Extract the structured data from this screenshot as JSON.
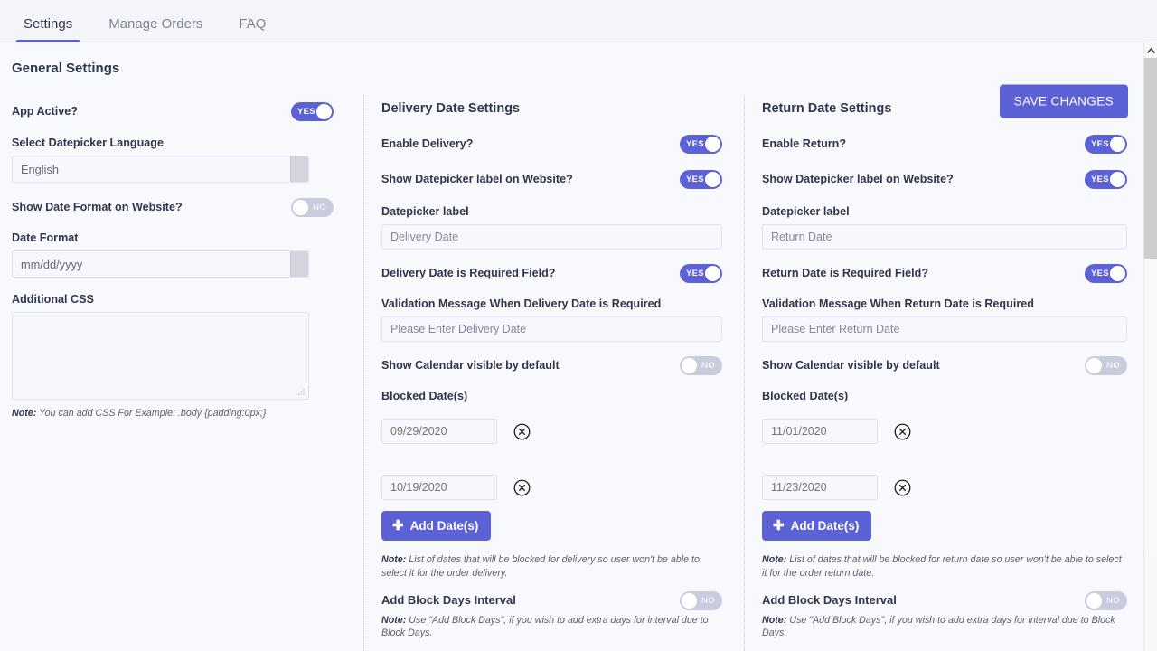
{
  "tabs": [
    {
      "label": "Settings",
      "active": true
    },
    {
      "label": "Manage Orders",
      "active": false
    },
    {
      "label": "FAQ",
      "active": false
    }
  ],
  "header": {
    "title": "General Settings",
    "save_label": "SAVE CHANGES"
  },
  "colors": {
    "accent": "#5c61d6",
    "toggle_on": "#5c61d6",
    "toggle_off": "#c9ccdd",
    "text": "#31364f",
    "page_bg": "#f8f9fc"
  },
  "general": {
    "app_active": {
      "label": "App Active?",
      "value": "YES",
      "on": true
    },
    "language": {
      "label": "Select Datepicker Language",
      "value": "English"
    },
    "show_date_format": {
      "label": "Show Date Format on Website?",
      "value": "NO",
      "on": false
    },
    "date_format": {
      "label": "Date Format",
      "value": "mm/dd/yyyy"
    },
    "additional_css": {
      "label": "Additional CSS",
      "value": "",
      "placeholder": ""
    },
    "css_note_prefix": "Note:",
    "css_note": " You can add CSS For Example: .body {padding:0px;}"
  },
  "delivery": {
    "title": "Delivery Date Settings",
    "enable": {
      "label": "Enable Delivery?",
      "value": "YES",
      "on": true
    },
    "show_label": {
      "label": "Show Datepicker label on Website?",
      "value": "YES",
      "on": true
    },
    "datepicker_label": {
      "label": "Datepicker label",
      "value": "Delivery Date"
    },
    "required": {
      "label": "Delivery Date is Required Field?",
      "value": "YES",
      "on": true
    },
    "validation": {
      "label": "Validation Message When Delivery Date is Required",
      "value": "Please Enter Delivery Date"
    },
    "calendar_visible": {
      "label": "Show Calendar visible by default",
      "value": "NO",
      "on": false
    },
    "blocked_label": "Blocked Date(s)",
    "blocked_dates": [
      "09/29/2020",
      "10/19/2020"
    ],
    "add_button": "Add Date(s)",
    "note_prefix": "Note:",
    "note": " List of dates that will be blocked for delivery so user won't be able to select it for the order delivery.",
    "block_interval": {
      "label": "Add Block Days Interval",
      "value": "NO",
      "on": false
    },
    "block_note_prefix": "Note:",
    "block_note": " Use \"Add Block Days\", if you wish to add extra days for interval due to Block Days."
  },
  "return": {
    "title": "Return Date Settings",
    "enable": {
      "label": "Enable Return?",
      "value": "YES",
      "on": true
    },
    "show_label": {
      "label": "Show Datepicker label on Website?",
      "value": "YES",
      "on": true
    },
    "datepicker_label": {
      "label": "Datepicker label",
      "value": "Return Date"
    },
    "required": {
      "label": "Return Date is Required Field?",
      "value": "YES",
      "on": true
    },
    "validation": {
      "label": "Validation Message When Return Date is Required",
      "value": "Please Enter Return Date"
    },
    "calendar_visible": {
      "label": "Show Calendar visible by default",
      "value": "NO",
      "on": false
    },
    "blocked_label": "Blocked Date(s)",
    "blocked_dates": [
      "11/01/2020",
      "11/23/2020"
    ],
    "add_button": "Add Date(s)",
    "note_prefix": "Note:",
    "note": " List of dates that will be blocked for return date so user won't be able to select it for the order return date.",
    "block_interval": {
      "label": "Add Block Days Interval",
      "value": "NO",
      "on": false
    },
    "block_note_prefix": "Note:",
    "block_note": " Use \"Add Block Days\", if you wish to add extra days for interval due to Block Days."
  },
  "scrollbar": {
    "up_icon": "chevron-up-icon"
  }
}
